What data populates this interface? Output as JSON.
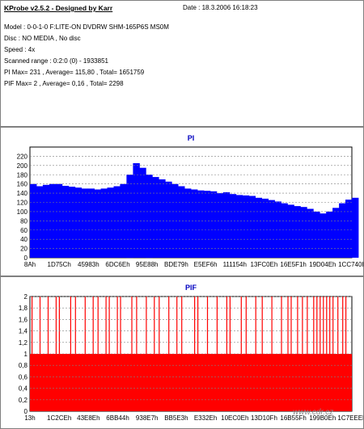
{
  "header": {
    "title": "KProbe v2.5.2 - Designed by Karr",
    "date": "Date : 18.3.2006 16:18:23",
    "lines": [
      "Model : 0-0-1-0 F:LITE-ON DVDRW SHM-165P6S MS0M",
      "Disc : NO MEDIA , No disc",
      "Speed : 4x",
      "Scanned range : 0:2:0 (0) - 1933851",
      "PI Max= 231 , Average= 115,80 , Total= 1651759",
      "PIF Max= 2 , Average= 0,16 , Total= 2298"
    ]
  },
  "colors": {
    "series": "#0000ff",
    "pif_series": "#ff0000",
    "title": "#0000c0",
    "grid": "#808080"
  },
  "watermark": "www.cdr.cz",
  "chart_data": [
    {
      "type": "bar",
      "title": "PI",
      "ylim": [
        0,
        240
      ],
      "yticks": [
        0,
        20,
        40,
        60,
        80,
        100,
        120,
        140,
        160,
        180,
        200,
        220
      ],
      "xticks": [
        "8Ah",
        "1D75Ch",
        "45983h",
        "6DC6Eh",
        "95E88h",
        "BDE79h",
        "E5EF6h",
        "111154h",
        "13FC0Eh",
        "16E5F1h",
        "19D04Eh",
        "1CC740h"
      ],
      "grid": true,
      "x": [
        0,
        2,
        4,
        6,
        8,
        10,
        12,
        14,
        16,
        18,
        20,
        22,
        24,
        26,
        28,
        30,
        32,
        34,
        36,
        38,
        40,
        42,
        44,
        46,
        48,
        50,
        52,
        54,
        56,
        58,
        60,
        62,
        64,
        66,
        68,
        70,
        72,
        74,
        76,
        78,
        80,
        82,
        84,
        86,
        88,
        90,
        92,
        94,
        96,
        98,
        100
      ],
      "values": [
        160,
        155,
        158,
        160,
        160,
        156,
        154,
        152,
        150,
        150,
        148,
        150,
        152,
        155,
        160,
        180,
        205,
        195,
        180,
        175,
        170,
        165,
        160,
        155,
        150,
        148,
        146,
        145,
        144,
        140,
        142,
        138,
        136,
        135,
        134,
        130,
        128,
        125,
        122,
        118,
        115,
        112,
        110,
        106,
        100,
        96,
        100,
        108,
        118,
        126,
        130
      ],
      "series_name": ""
    },
    {
      "type": "bar",
      "title": "PIF",
      "ylim": [
        0,
        2
      ],
      "yticks": [
        "0",
        "0,2",
        "0,4",
        "0,6",
        "0,8",
        "1",
        "1,2",
        "1,4",
        "1,6",
        "1,8",
        "2"
      ],
      "xticks": [
        "13h",
        "1C2CEh",
        "43E8Eh",
        "6BB44h",
        "938E7h",
        "BB5E3h",
        "E332Eh",
        "10EC0Eh",
        "13D10Fh",
        "16B55Fh",
        "199B0Eh",
        "1C7EEEh"
      ],
      "grid": true,
      "base_value": 1,
      "peaks_x_percent": [
        0.5,
        3,
        5.5,
        8,
        9,
        12.5,
        14,
        17,
        19.5,
        21,
        23.5,
        24.5,
        27,
        28,
        31.5,
        33,
        36,
        38.5,
        40,
        43,
        45.5,
        47,
        51,
        52,
        55,
        58,
        61,
        62,
        65.5,
        67,
        70,
        72,
        75,
        78,
        80,
        81,
        83,
        84.5,
        86,
        88,
        89,
        90,
        91,
        92,
        93,
        94,
        95.5,
        97,
        98
      ],
      "peak_value": 2,
      "series_name": ""
    }
  ]
}
